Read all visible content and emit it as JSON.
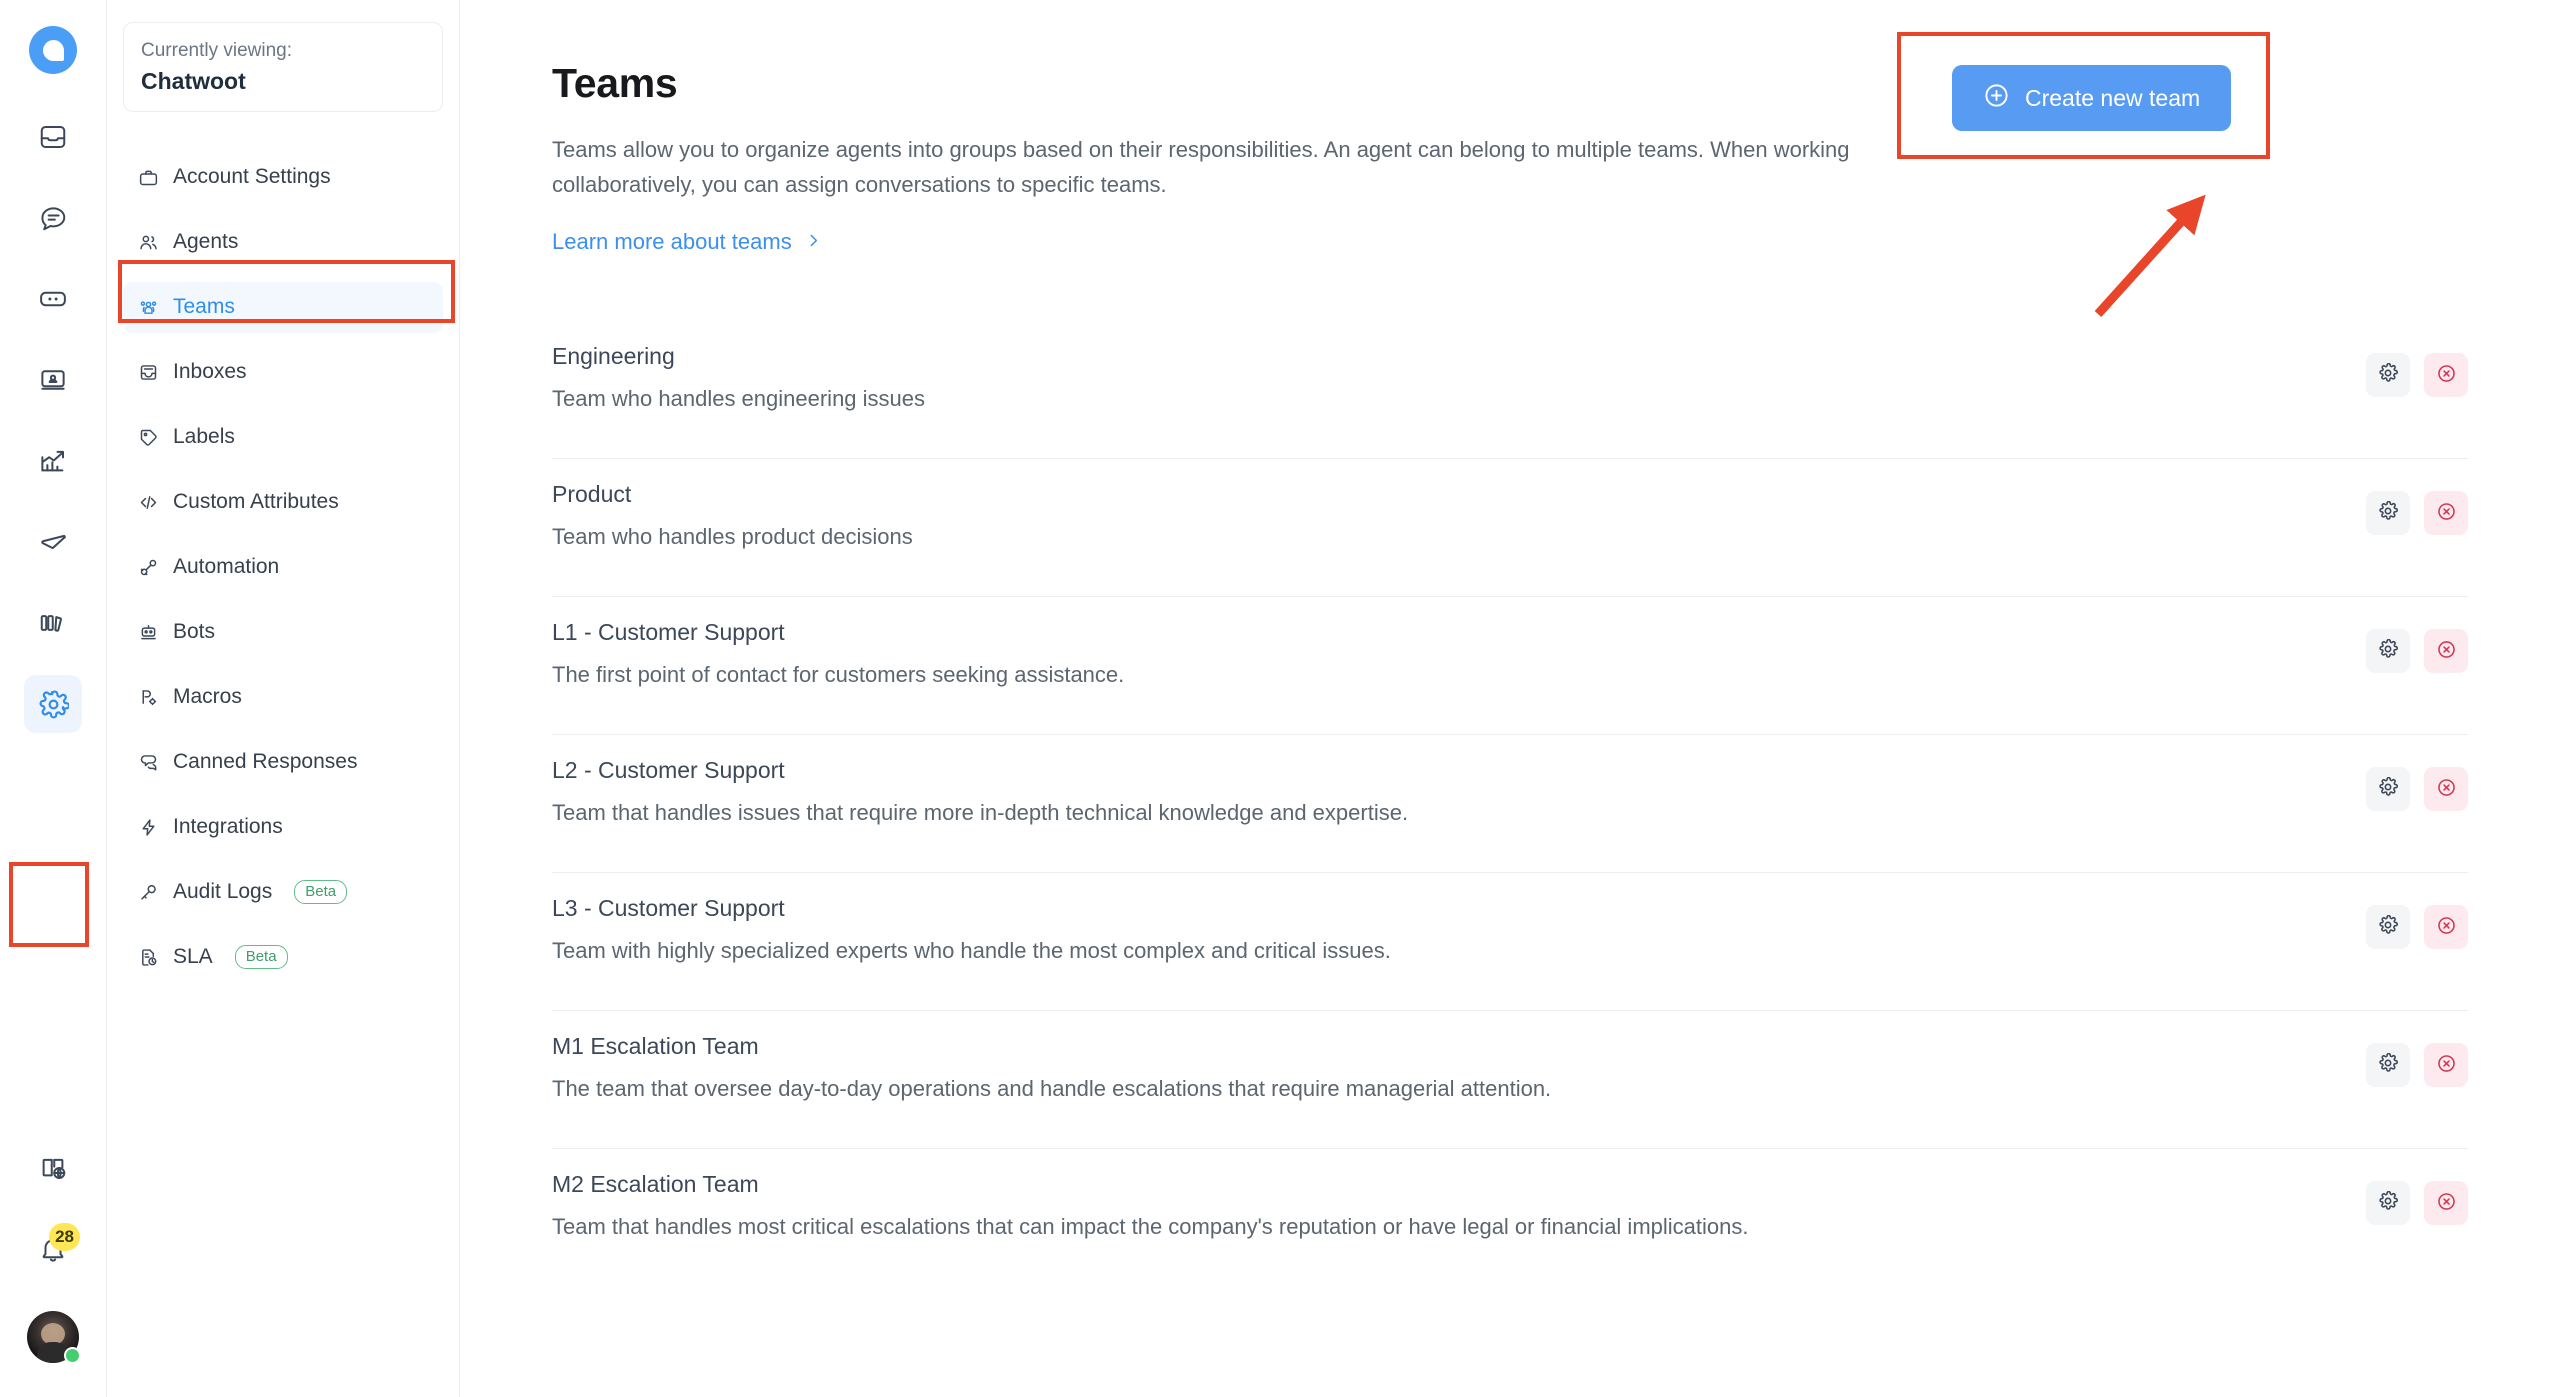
{
  "rail": {
    "logo_name": "chatwoot-logo",
    "items": [
      {
        "name": "inbox-icon",
        "label": "Inbox"
      },
      {
        "name": "conversations-icon",
        "label": "Conversations"
      },
      {
        "name": "contacts-icon",
        "label": "Contacts"
      },
      {
        "name": "captain-icon",
        "label": "Captain"
      },
      {
        "name": "reports-icon",
        "label": "Reports"
      },
      {
        "name": "campaigns-icon",
        "label": "Campaigns"
      },
      {
        "name": "portal-icon",
        "label": "Help Center"
      },
      {
        "name": "settings-icon",
        "label": "Settings"
      }
    ],
    "bottom": [
      {
        "name": "docs-icon",
        "label": "Docs"
      },
      {
        "name": "notifications-bell-icon",
        "label": "Notifications",
        "badge": "28"
      },
      {
        "name": "avatar",
        "label": "Profile"
      }
    ]
  },
  "sidebar": {
    "account_card": {
      "currently_viewing_label": "Currently viewing:",
      "account_name": "Chatwoot"
    },
    "items": [
      {
        "label": "Account Settings",
        "icon": "briefcase-icon",
        "active": false
      },
      {
        "label": "Agents",
        "icon": "people-icon",
        "active": false
      },
      {
        "label": "Teams",
        "icon": "teams-icon",
        "active": true
      },
      {
        "label": "Inboxes",
        "icon": "inbox-archive-icon",
        "active": false
      },
      {
        "label": "Labels",
        "icon": "tag-icon",
        "active": false
      },
      {
        "label": "Custom Attributes",
        "icon": "code-icon",
        "active": false
      },
      {
        "label": "Automation",
        "icon": "automation-icon",
        "active": false
      },
      {
        "label": "Bots",
        "icon": "robot-icon",
        "active": false
      },
      {
        "label": "Macros",
        "icon": "macro-icon",
        "active": false
      },
      {
        "label": "Canned Responses",
        "icon": "chat-bubbles-icon",
        "active": false
      },
      {
        "label": "Integrations",
        "icon": "lightning-icon",
        "active": false
      },
      {
        "label": "Audit Logs",
        "icon": "key-icon",
        "active": false,
        "badge": "Beta"
      },
      {
        "label": "SLA",
        "icon": "document-clock-icon",
        "active": false,
        "badge": "Beta"
      }
    ]
  },
  "main": {
    "title": "Teams",
    "description": "Teams allow you to organize agents into groups based on their responsibilities. An agent can belong to multiple teams. When working collaboratively, you can assign conversations to specific teams.",
    "learn_more_label": "Learn more about teams",
    "create_button_label": "Create new team",
    "create_button_icon": "plus-circle-icon",
    "row_action_settings_icon": "gear-icon",
    "row_action_delete_icon": "close-circle-icon",
    "teams": [
      {
        "name": "Engineering",
        "description": "Team who handles engineering issues"
      },
      {
        "name": "Product",
        "description": "Team who handles product decisions"
      },
      {
        "name": "L1 - Customer Support",
        "description": "The first point of contact for customers seeking assistance."
      },
      {
        "name": "L2 - Customer Support",
        "description": "Team that handles issues that require more in-depth technical knowledge and expertise."
      },
      {
        "name": "L3 - Customer Support",
        "description": "Team with highly specialized experts who handle the most complex and critical issues."
      },
      {
        "name": "M1 Escalation Team",
        "description": "The team that oversee day-to-day operations and handle escalations that require managerial attention."
      },
      {
        "name": "M2 Escalation Team",
        "description": "Team that handles most critical escalations that can impact the company's reputation or have legal or financial implications."
      }
    ]
  },
  "annotations": {
    "highlight_color": "#e8452a",
    "boxes": [
      "settings-rail-icon",
      "teams-sidebar-item",
      "create-new-team-button"
    ],
    "arrow": "points-to-create-new-team-button"
  },
  "colors": {
    "accent_blue": "#589bf3",
    "link_blue": "#3b8ff0",
    "active_bg": "#f2f8fe",
    "annotation_red": "#e8452a",
    "beta_green": "#3f9e6b",
    "badge_yellow": "#ffe654",
    "delete_red": "#d03a56"
  }
}
